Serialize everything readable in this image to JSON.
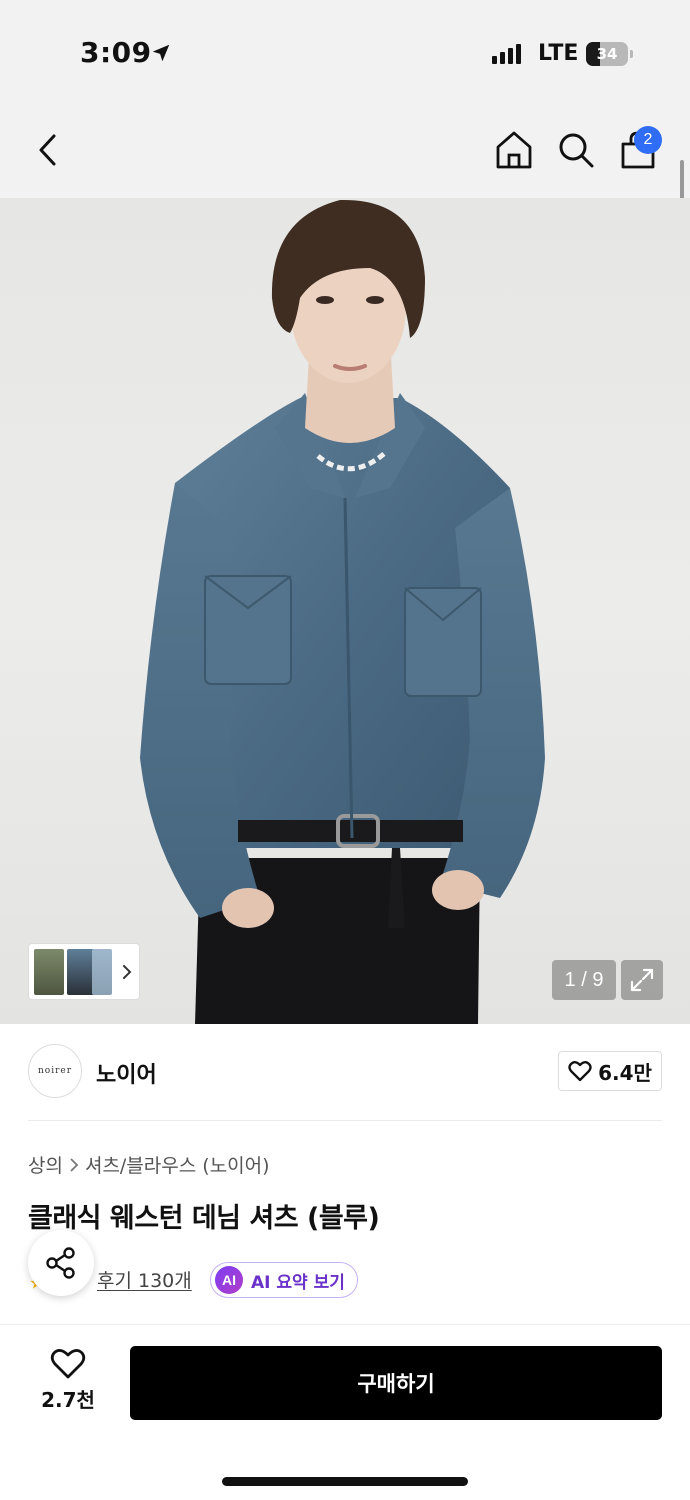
{
  "status_bar": {
    "time": "3:09",
    "network": "LTE",
    "battery": "34",
    "battery_level": 0.34
  },
  "nav": {
    "back_icon": "chevron-left-icon",
    "home_icon": "home-icon",
    "search_icon": "search-icon",
    "cart_icon": "shopping-bag-icon",
    "cart_count": "2"
  },
  "gallery": {
    "counter": "1 / 9",
    "expand_icon": "expand-icon",
    "thumbnails_icon": "chevron-right-icon"
  },
  "brand": {
    "logo_text": "noirer",
    "name": "노이어",
    "like_count": "6.4만"
  },
  "breadcrumb": {
    "category": "상의",
    "subcategory": "셔츠/블라우스 (노이어)"
  },
  "product": {
    "title": "클래식 웨스턴 데님 셔츠 (블루)",
    "review_link": "후기 130개",
    "ai_badge": "AI",
    "ai_summary": "AI 요약 보기"
  },
  "bottom": {
    "wish_count": "2.7천",
    "buy_label": "구매하기"
  },
  "colors": {
    "accent_blue": "#2f6df6",
    "ai_purple": "#7b3ff2",
    "buy_button": "#000000"
  }
}
